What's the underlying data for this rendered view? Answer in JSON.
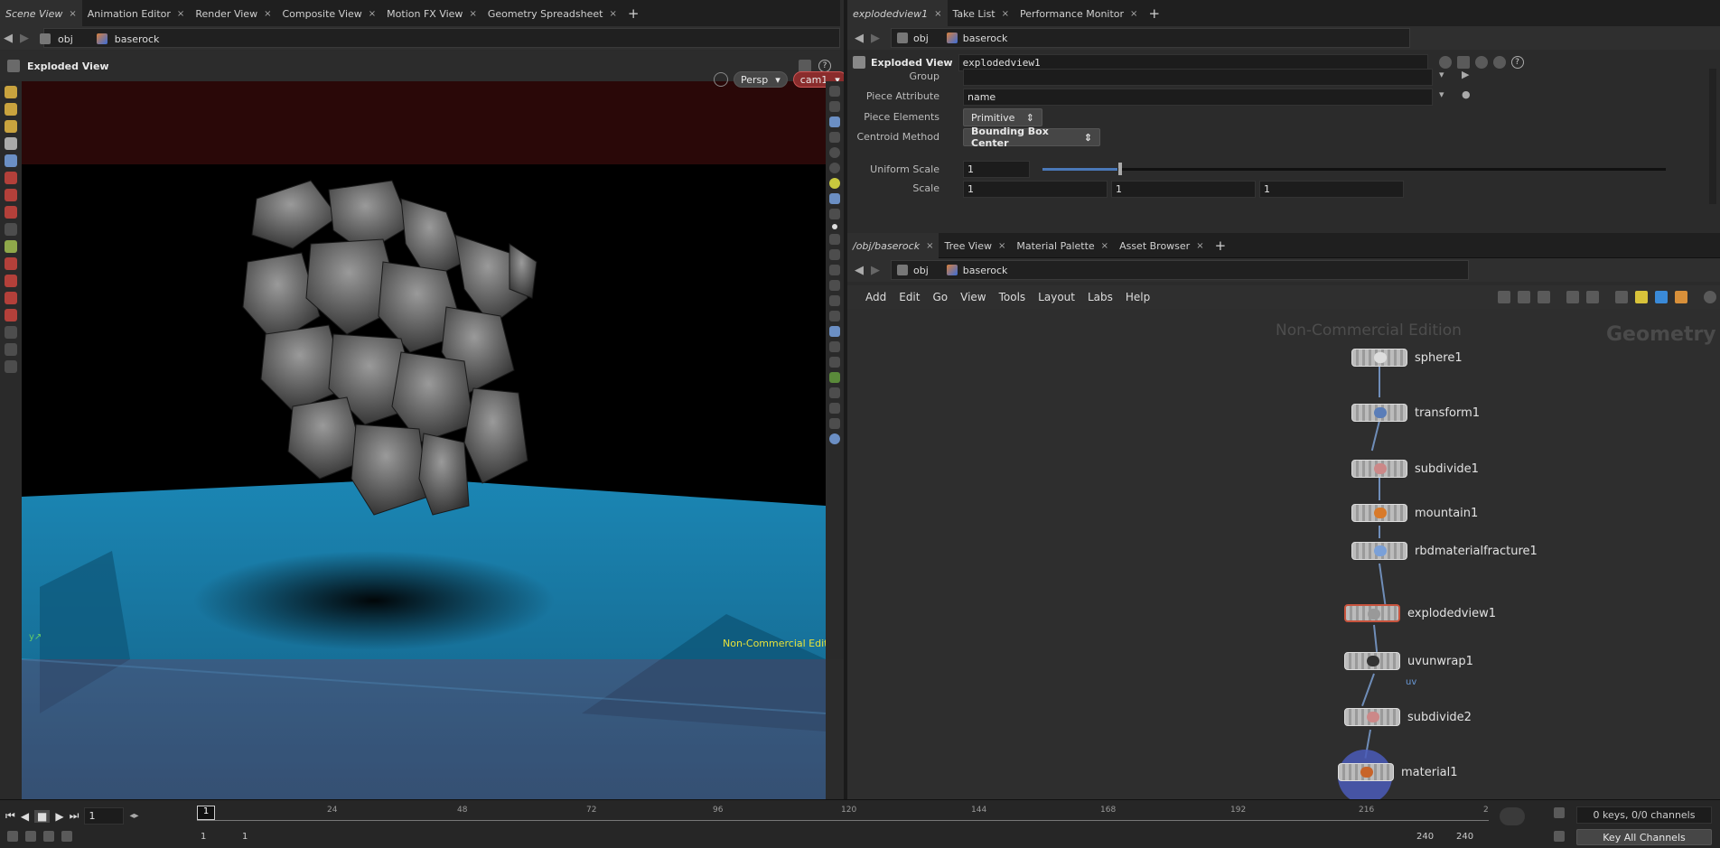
{
  "left_tabs": [
    "Scene View",
    "Animation Editor",
    "Render View",
    "Composite View",
    "Motion FX View",
    "Geometry Spreadsheet"
  ],
  "left_path": {
    "root": "obj",
    "node": "baserock"
  },
  "viewport": {
    "title": "Exploded View",
    "persp_label": "Persp",
    "cam_label": "cam1",
    "watermark": "Non-Commercial Edition"
  },
  "right_top_tabs": [
    "explodedview1",
    "Take List",
    "Performance Monitor"
  ],
  "right_top_path": {
    "root": "obj",
    "node": "baserock"
  },
  "params": {
    "node_type": "Exploded View",
    "node_name": "explodedview1",
    "group_label": "Group",
    "group_value": "",
    "piece_attr_label": "Piece Attribute",
    "piece_attr_value": "name",
    "piece_elements_label": "Piece Elements",
    "piece_elements_value": "Primitive",
    "centroid_label": "Centroid Method",
    "centroid_value": "Bounding Box Center",
    "uniform_scale_label": "Uniform Scale",
    "uniform_scale_value": "1",
    "scale_label": "Scale",
    "scale_x": "1",
    "scale_y": "1",
    "scale_z": "1"
  },
  "right_bottom_tabs": [
    "/obj/baserock",
    "Tree View",
    "Material Palette",
    "Asset Browser"
  ],
  "right_bottom_path": {
    "root": "obj",
    "node": "baserock"
  },
  "network_menu": [
    "Add",
    "Edit",
    "Go",
    "View",
    "Tools",
    "Layout",
    "Labs",
    "Help"
  ],
  "network": {
    "watermark": "Non-Commercial Edition",
    "context": "Geometry",
    "nodes": [
      "sphere1",
      "transform1",
      "subdivide1",
      "mountain1",
      "rbdmaterialfracture1",
      "explodedview1",
      "uvunwrap1",
      "subdivide2",
      "material1"
    ],
    "uv_tag": "uv"
  },
  "timeline": {
    "frame": "1",
    "current_marker": "1",
    "ticks": [
      "24",
      "48",
      "72",
      "96",
      "120",
      "144",
      "168",
      "192",
      "216",
      "2"
    ],
    "keys_status": "0 keys, 0/0 channels",
    "key_all": "Key All Channels",
    "start_a": "1",
    "start_b": "1",
    "end_a": "240",
    "end_b": "240"
  },
  "colors": {
    "accent_red": "#c8543e",
    "floor_blue": "#1f7faa",
    "wire": "#6f8db8"
  }
}
